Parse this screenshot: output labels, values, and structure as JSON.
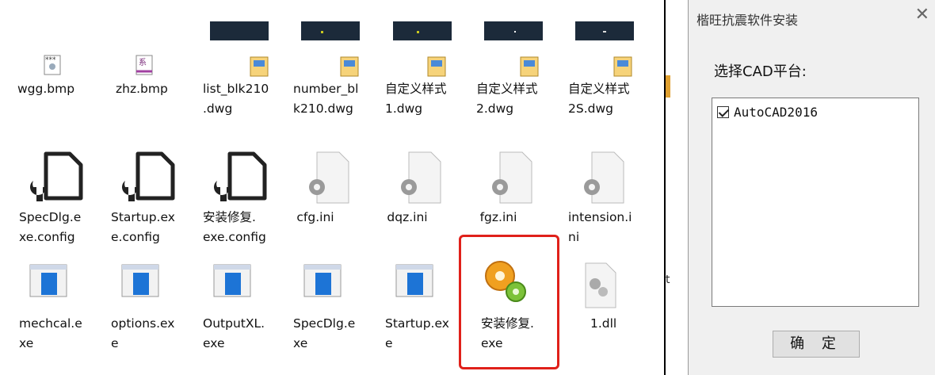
{
  "files_row1": [
    {
      "name": "wgg.bmp",
      "icon": "bmp-icon"
    },
    {
      "name": "zhz.bmp",
      "icon": "bmp-icon"
    },
    {
      "name": "list_blk210\n.dwg",
      "icon": "dwg-icon"
    },
    {
      "name": "number_bl\nk210.dwg",
      "icon": "dwg-icon"
    },
    {
      "name": "自定义样式\n1.dwg",
      "icon": "dwg-icon"
    },
    {
      "name": "自定义样式\n2.dwg",
      "icon": "dwg-icon"
    },
    {
      "name": "自定义样式\n2S.dwg",
      "icon": "dwg-icon"
    }
  ],
  "files_row2": [
    {
      "name": "SpecDlg.e\nxe.config",
      "icon": "config-icon"
    },
    {
      "name": "Startup.ex\ne.config",
      "icon": "config-icon"
    },
    {
      "name": "安装修复.\nexe.config",
      "icon": "config-icon"
    },
    {
      "name": "cfg.ini",
      "icon": "ini-icon"
    },
    {
      "name": "dqz.ini",
      "icon": "ini-icon"
    },
    {
      "name": "fgz.ini",
      "icon": "ini-icon"
    },
    {
      "name": "intension.i\nni",
      "icon": "ini-icon"
    }
  ],
  "files_row3": [
    {
      "name": "mechcal.e\nxe",
      "icon": "exe-window-icon"
    },
    {
      "name": "options.ex\ne",
      "icon": "exe-window-icon"
    },
    {
      "name": "OutputXL.\nexe",
      "icon": "exe-window-icon"
    },
    {
      "name": "SpecDlg.e\nxe",
      "icon": "exe-window-icon"
    },
    {
      "name": "Startup.ex\ne",
      "icon": "exe-window-icon"
    },
    {
      "name": "安装修复.\nexe",
      "icon": "gears-icon"
    },
    {
      "name": "1.dll",
      "icon": "dll-icon"
    }
  ],
  "dialog": {
    "title": "楷旺抗震软件安装",
    "close": "✕",
    "platform_label": "选择CAD平台:",
    "platforms": [
      {
        "name": "AutoCAD2016",
        "checked": true
      }
    ],
    "ok_button": "确 定"
  },
  "colors": {
    "highlight": "#e0201a",
    "dialog_bg": "#f0f0f0"
  }
}
